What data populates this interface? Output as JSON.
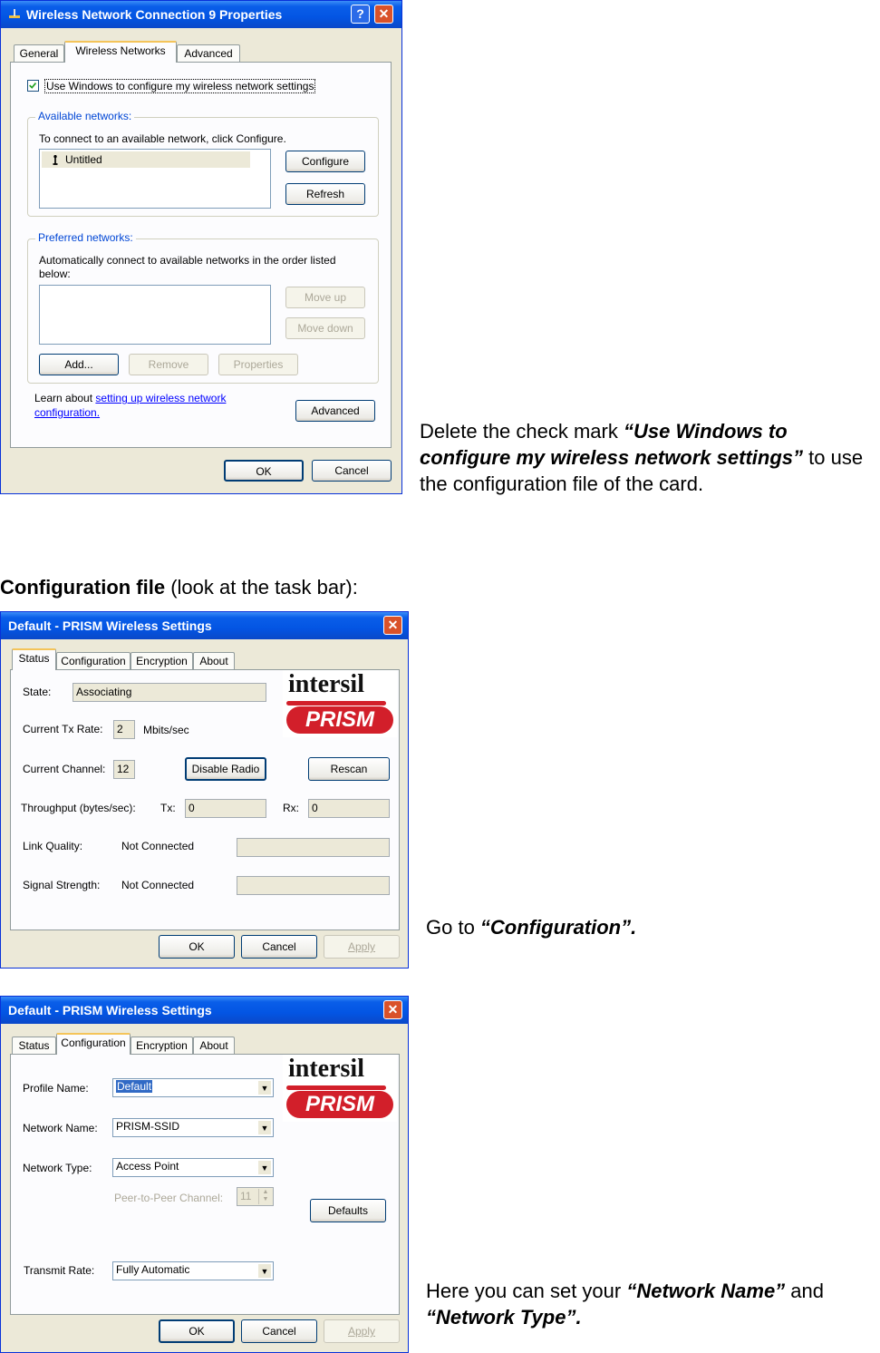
{
  "win1": {
    "title": "Wireless Network Connection 9 Properties",
    "tabs": [
      "General",
      "Wireless Networks",
      "Advanced"
    ],
    "use_windows_checkbox": "Use Windows to configure my wireless network settings",
    "available_group": "Available networks:",
    "available_desc": "To connect to an available network, click Configure.",
    "available_item": "Untitled",
    "configure_button": "Configure",
    "refresh_button": "Refresh",
    "preferred_group": "Preferred networks:",
    "preferred_desc": "Automatically connect to available networks in the order listed below:",
    "move_up_button": "Move up",
    "move_down_button": "Move down",
    "add_button": "Add...",
    "remove_button": "Remove",
    "properties_button": "Properties",
    "learn_prefix": "Learn about ",
    "learn_link": "setting up wireless network configuration.",
    "advanced_button": "Advanced",
    "ok_button": "OK",
    "cancel_button": "Cancel",
    "help_glyph": "?",
    "close_glyph": "✕"
  },
  "caption1": {
    "prefix": "Delete the check mark ",
    "emphasis": "“Use Windows to configure my wireless network settings”",
    "suffix": " to use the configuration file of the card."
  },
  "section_heading": {
    "bold": "Configuration file",
    "rest": " (look at the task bar):"
  },
  "win2": {
    "title": "Default - PRISM Wireless Settings",
    "tabs": [
      "Status",
      "Configuration",
      "Encryption",
      "About"
    ],
    "state_label": "State:",
    "state_value": "Associating",
    "tx_rate_label": "Current Tx Rate:",
    "tx_rate_value": "2",
    "tx_rate_unit": "Mbits/sec",
    "channel_label": "Current Channel:",
    "channel_value": "12",
    "disable_radio_button": "Disable Radio",
    "rescan_button": "Rescan",
    "throughput_label": "Throughput (bytes/sec):",
    "tx_label": "Tx:",
    "tx_value": "0",
    "rx_label": "Rx:",
    "rx_value": "0",
    "link_quality_label": "Link Quality:",
    "link_quality_value": "Not Connected",
    "signal_label": "Signal Strength:",
    "signal_value": "Not Connected",
    "ok_button": "OK",
    "cancel_button": "Cancel",
    "apply_button": "Apply",
    "logo_top": "intersil",
    "logo_bottom": "PRISM",
    "close_glyph": "✕"
  },
  "caption2": {
    "prefix": "Go to ",
    "emphasis": "“Configuration”."
  },
  "win3": {
    "title": "Default - PRISM Wireless Settings",
    "tabs": [
      "Status",
      "Configuration",
      "Encryption",
      "About"
    ],
    "profile_label": "Profile Name:",
    "profile_value": "Default",
    "network_name_label": "Network Name:",
    "network_name_value": "PRISM-SSID",
    "network_type_label": "Network Type:",
    "network_type_value": "Access Point",
    "p2p_label": "Peer-to-Peer Channel:",
    "p2p_value": "11",
    "defaults_button": "Defaults",
    "transmit_label": "Transmit Rate:",
    "transmit_value": "Fully Automatic",
    "ok_button": "OK",
    "cancel_button": "Cancel",
    "apply_button": "Apply",
    "logo_top": "intersil",
    "logo_bottom": "PRISM",
    "close_glyph": "✕"
  },
  "caption3": {
    "prefix": "Here you can set your ",
    "emphasis1": "“Network Name”",
    "middle": " and ",
    "emphasis2": "“Network Type”."
  },
  "colors": {
    "title_blue": "#0355e3",
    "close_red": "#d9522a",
    "dialog_bg": "#ece9d8",
    "link": "#0000ff"
  }
}
